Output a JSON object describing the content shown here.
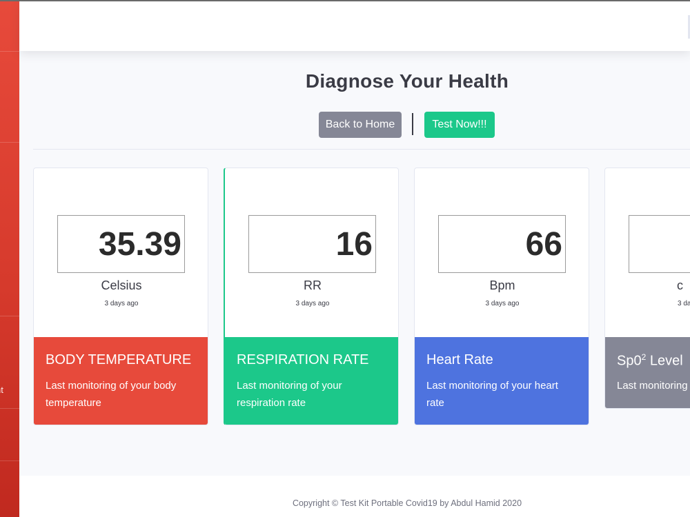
{
  "sidebar": {
    "fragment_text": "nt"
  },
  "main": {
    "title": "Diagnose Your Health",
    "buttons": {
      "home": "Back to Home",
      "test": "Test Now!!!"
    }
  },
  "cards": [
    {
      "value": "35.39",
      "unit": "Celsius",
      "time": "3 days ago",
      "title": "BODY TEMPERATURE",
      "description": "Last monitoring of your body temperature",
      "color": "#e74a3b"
    },
    {
      "value": "16",
      "unit": "RR",
      "time": "3 days ago",
      "title": "RESPIRATION RATE",
      "description": "Last monitoring of your respiration rate",
      "color": "#1cc88a"
    },
    {
      "value": "66",
      "unit": "Bpm",
      "time": "3 days ago",
      "title": "Heart Rate",
      "description": "Last monitoring of your heart rate",
      "color": "#4e73df"
    },
    {
      "value": "",
      "unit": "c",
      "time": "3 da",
      "title_main": "Sp0",
      "title_sup": "2",
      "title_rest": " Level",
      "description": "Last monitoring",
      "color": "#858796"
    }
  ],
  "footer": {
    "copyright": "Copyright © Test Kit Portable Covid19 by Abdul Hamid 2020"
  }
}
